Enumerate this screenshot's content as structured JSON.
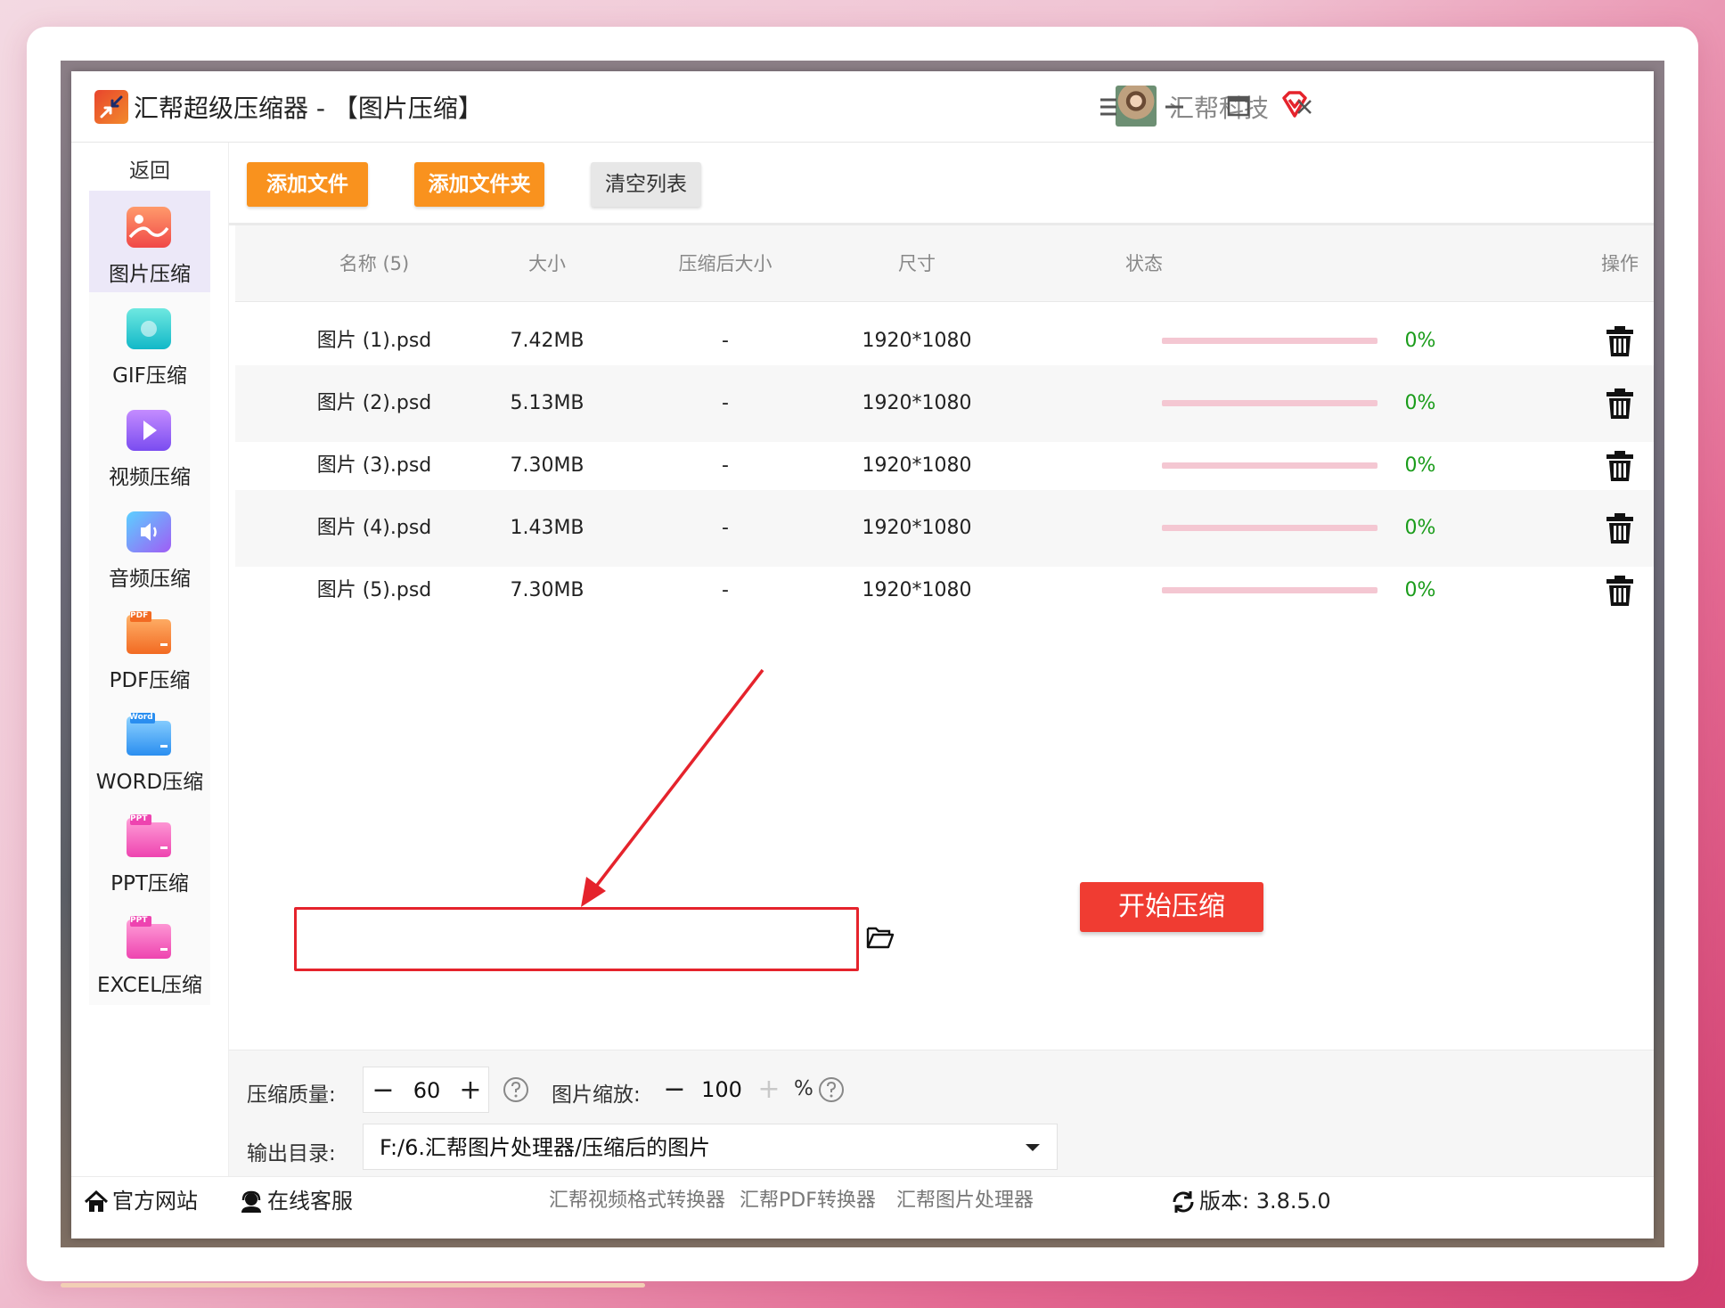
{
  "window": {
    "title": "汇帮超级压缩器",
    "title_section": " - 【图片压缩】",
    "company": "汇帮科技"
  },
  "sidebar": {
    "back_label": "返回",
    "items": [
      {
        "label": "图片压缩",
        "icon": "image-icon",
        "active": true
      },
      {
        "label": "GIF压缩",
        "icon": "gif-icon"
      },
      {
        "label": "视频压缩",
        "icon": "video-icon"
      },
      {
        "label": "音频压缩",
        "icon": "audio-icon"
      },
      {
        "label": "PDF压缩",
        "icon": "pdf-folder-icon",
        "badge": "PDF"
      },
      {
        "label": "WORD压缩",
        "icon": "word-folder-icon",
        "badge": "Word"
      },
      {
        "label": "PPT压缩",
        "icon": "ppt-folder-icon",
        "badge": "PPT"
      },
      {
        "label": "EXCEL压缩",
        "icon": "excel-folder-icon",
        "badge": "PPT"
      }
    ]
  },
  "toolbar": {
    "add_file": "添加文件",
    "add_folder": "添加文件夹",
    "clear_list": "清空列表"
  },
  "table": {
    "headers": {
      "name": "名称 (5)",
      "size": "大小",
      "compressed_size": "压缩后大小",
      "dimensions": "尺寸",
      "status": "状态",
      "action": "操作"
    },
    "rows": [
      {
        "name": "图片 (1).psd",
        "size": "7.42MB",
        "compressed": "-",
        "dimensions": "1920*1080",
        "progress": 0,
        "percent": "0%"
      },
      {
        "name": "图片 (2).psd",
        "size": "5.13MB",
        "compressed": "-",
        "dimensions": "1920*1080",
        "progress": 0,
        "percent": "0%"
      },
      {
        "name": "图片 (3).psd",
        "size": "7.30MB",
        "compressed": "-",
        "dimensions": "1920*1080",
        "progress": 0,
        "percent": "0%"
      },
      {
        "name": "图片 (4).psd",
        "size": "1.43MB",
        "compressed": "-",
        "dimensions": "1920*1080",
        "progress": 0,
        "percent": "0%"
      },
      {
        "name": "图片 (5).psd",
        "size": "7.30MB",
        "compressed": "-",
        "dimensions": "1920*1080",
        "progress": 0,
        "percent": "0%"
      }
    ]
  },
  "settings": {
    "quality_label": "压缩质量:",
    "quality_value": "60",
    "scale_label": "图片缩放:",
    "scale_value": "100",
    "scale_unit": "%",
    "output_label": "输出目录:",
    "output_path": "F:/6.汇帮图片处理器/压缩后的图片",
    "start_button": "开始压缩"
  },
  "footer": {
    "website": "官方网站",
    "support": "在线客服",
    "links": [
      "汇帮视频格式转换器",
      "汇帮PDF转换器",
      "汇帮图片处理器"
    ],
    "version": "版本: 3.8.5.0"
  },
  "colors": {
    "accent_orange": "#f9921e",
    "start_red": "#f03c32",
    "progress_track": "#f4c7d2",
    "percent_green": "#1a9c1a",
    "highlight_frame": "#e5232c"
  }
}
